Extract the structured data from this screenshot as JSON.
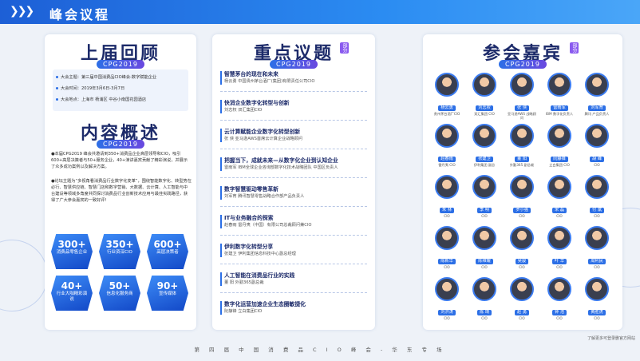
{
  "header": {
    "chevrons": "❯❯❯",
    "title": "峰会议程"
  },
  "left": {
    "title": "上届回顾",
    "tag": "CPG2019",
    "info": [
      "大会主题：第三届中国消费品CIO峰会-数字赋能企业",
      "大会时间：2019年3月6日-3月7日",
      "大会地点：上海市 杨浦区   中谷小南国花园酒店"
    ],
    "overview_title": "内容概述",
    "overview_tag": "CPG2019",
    "para1": "●本届CPG2019 峰会共邀请到350+消费品企业高层领导和CIO，吸引600+高层决策者与50+服务企业，40+演讲嘉宾贡献了精彩演说，并展示了众多成功案例以及解决方案。",
    "para2": "●论坛主题为“多视角看消费品行业数字化变革”，围绕智能数字化、转型势在必行、智慧供应链、智慧门店和数字营销、大数据、云计算、人工智能与中台建设等领域多角度共同探讨消费品行业创新技术应用与最佳实践路径，获得了广大参会嘉宾的一致好评!",
    "stats": [
      {
        "n": "300+",
        "l": "消费品零售企业"
      },
      {
        "n": "350+",
        "l": "行业资深CIO"
      },
      {
        "n": "600+",
        "l": "高层决策者"
      },
      {
        "n": "40+",
        "l": "行业大咖精彩演说"
      },
      {
        "n": "50+",
        "l": "信息化服务商"
      },
      {
        "n": "90+",
        "l": "宣传媒体"
      }
    ]
  },
  "middle": {
    "title": "重点议题",
    "tag": "CPG2019",
    "side": "部分",
    "topics": [
      {
        "t": "智慧茅台的现在和未来",
        "s": "杨云勇  中国贵州茅台酒厂(集团)有限责任公司CIO"
      },
      {
        "t": "快消企业数字化转型与创新",
        "s": "刘志权  双汇集团CIO"
      },
      {
        "t": "云计算赋能企业数字化转型创新",
        "s": "张  侠  亚马逊AWS首席云计算企业战略顾问"
      },
      {
        "t": "把握当下，成就未来—从数字化企业到认知企业",
        "s": "雷雨军  IBM全球企业咨询部数字化技术战略团队 中国区负责人"
      },
      {
        "t": "数字智慧驱动零售革新",
        "s": "刘军育  腾讯智慧零售战略合作部产品负责人"
      },
      {
        "t": "IT与业务融合的探索",
        "s": "赵春雨  雷丹夷（中国）有限公司总裁顾问兼CIO"
      },
      {
        "t": "伊利数字化转型分享",
        "s": "张建卫  伊利集团信息科技中心副总经理"
      },
      {
        "t": "人工智能在消费品行业的实践",
        "s": "董  阳  外勤365副总裁"
      },
      {
        "t": "数字化运营加速企业生态圈敏捷化",
        "s": "阮静锋  立白集团CIO"
      }
    ]
  },
  "right": {
    "title": "参会嘉宾",
    "tag": "CPG2019",
    "side": "部分",
    "guests": [
      {
        "nm": "杨云勇",
        "co": "贵州茅台酒厂CIO"
      },
      {
        "nm": "刘志权",
        "co": "双汇集团 CIO"
      },
      {
        "nm": "张 侠",
        "co": "亚马逊AWS 战略顾问"
      },
      {
        "nm": "雷雨军",
        "co": "IBM 数字化负责人"
      },
      {
        "nm": "刘军育",
        "co": "腾讯 产品负责人"
      },
      {
        "nm": "赵春雨",
        "co": "雷丹夷 CIO"
      },
      {
        "nm": "张建卫",
        "co": "伊利集团 副总"
      },
      {
        "nm": "董 阳",
        "co": "外勤365 副总裁"
      },
      {
        "nm": "阮静锋",
        "co": "立白集团 CIO"
      },
      {
        "nm": "胡 峰",
        "co": "CIO"
      },
      {
        "nm": "朱 林",
        "co": "CIO"
      },
      {
        "nm": "李 明",
        "co": "CIO"
      },
      {
        "nm": "罗小强",
        "co": "CIO"
      },
      {
        "nm": "宋 磊",
        "co": "CIO"
      },
      {
        "nm": "付 斌",
        "co": "CIO"
      },
      {
        "nm": "陈新华",
        "co": "CIO"
      },
      {
        "nm": "陈维耀",
        "co": "CIO"
      },
      {
        "nm": "吴骏",
        "co": "CIO"
      },
      {
        "nm": "叶 华",
        "co": "CIO"
      },
      {
        "nm": "周利民",
        "co": "CIO"
      },
      {
        "nm": "刘洪涛",
        "co": "CIO"
      },
      {
        "nm": "陈 琦",
        "co": "CIO"
      },
      {
        "nm": "赵 勇",
        "co": "CIO"
      },
      {
        "nm": "钟 浩",
        "co": "CIO"
      },
      {
        "nm": "黄胜虎",
        "co": "CIO"
      }
    ]
  },
  "footer": "第 四 届 中 国 消 费 品 C I O 峰 会 - 华 东 专 场",
  "note": "了解更多可登录删官方网站"
}
